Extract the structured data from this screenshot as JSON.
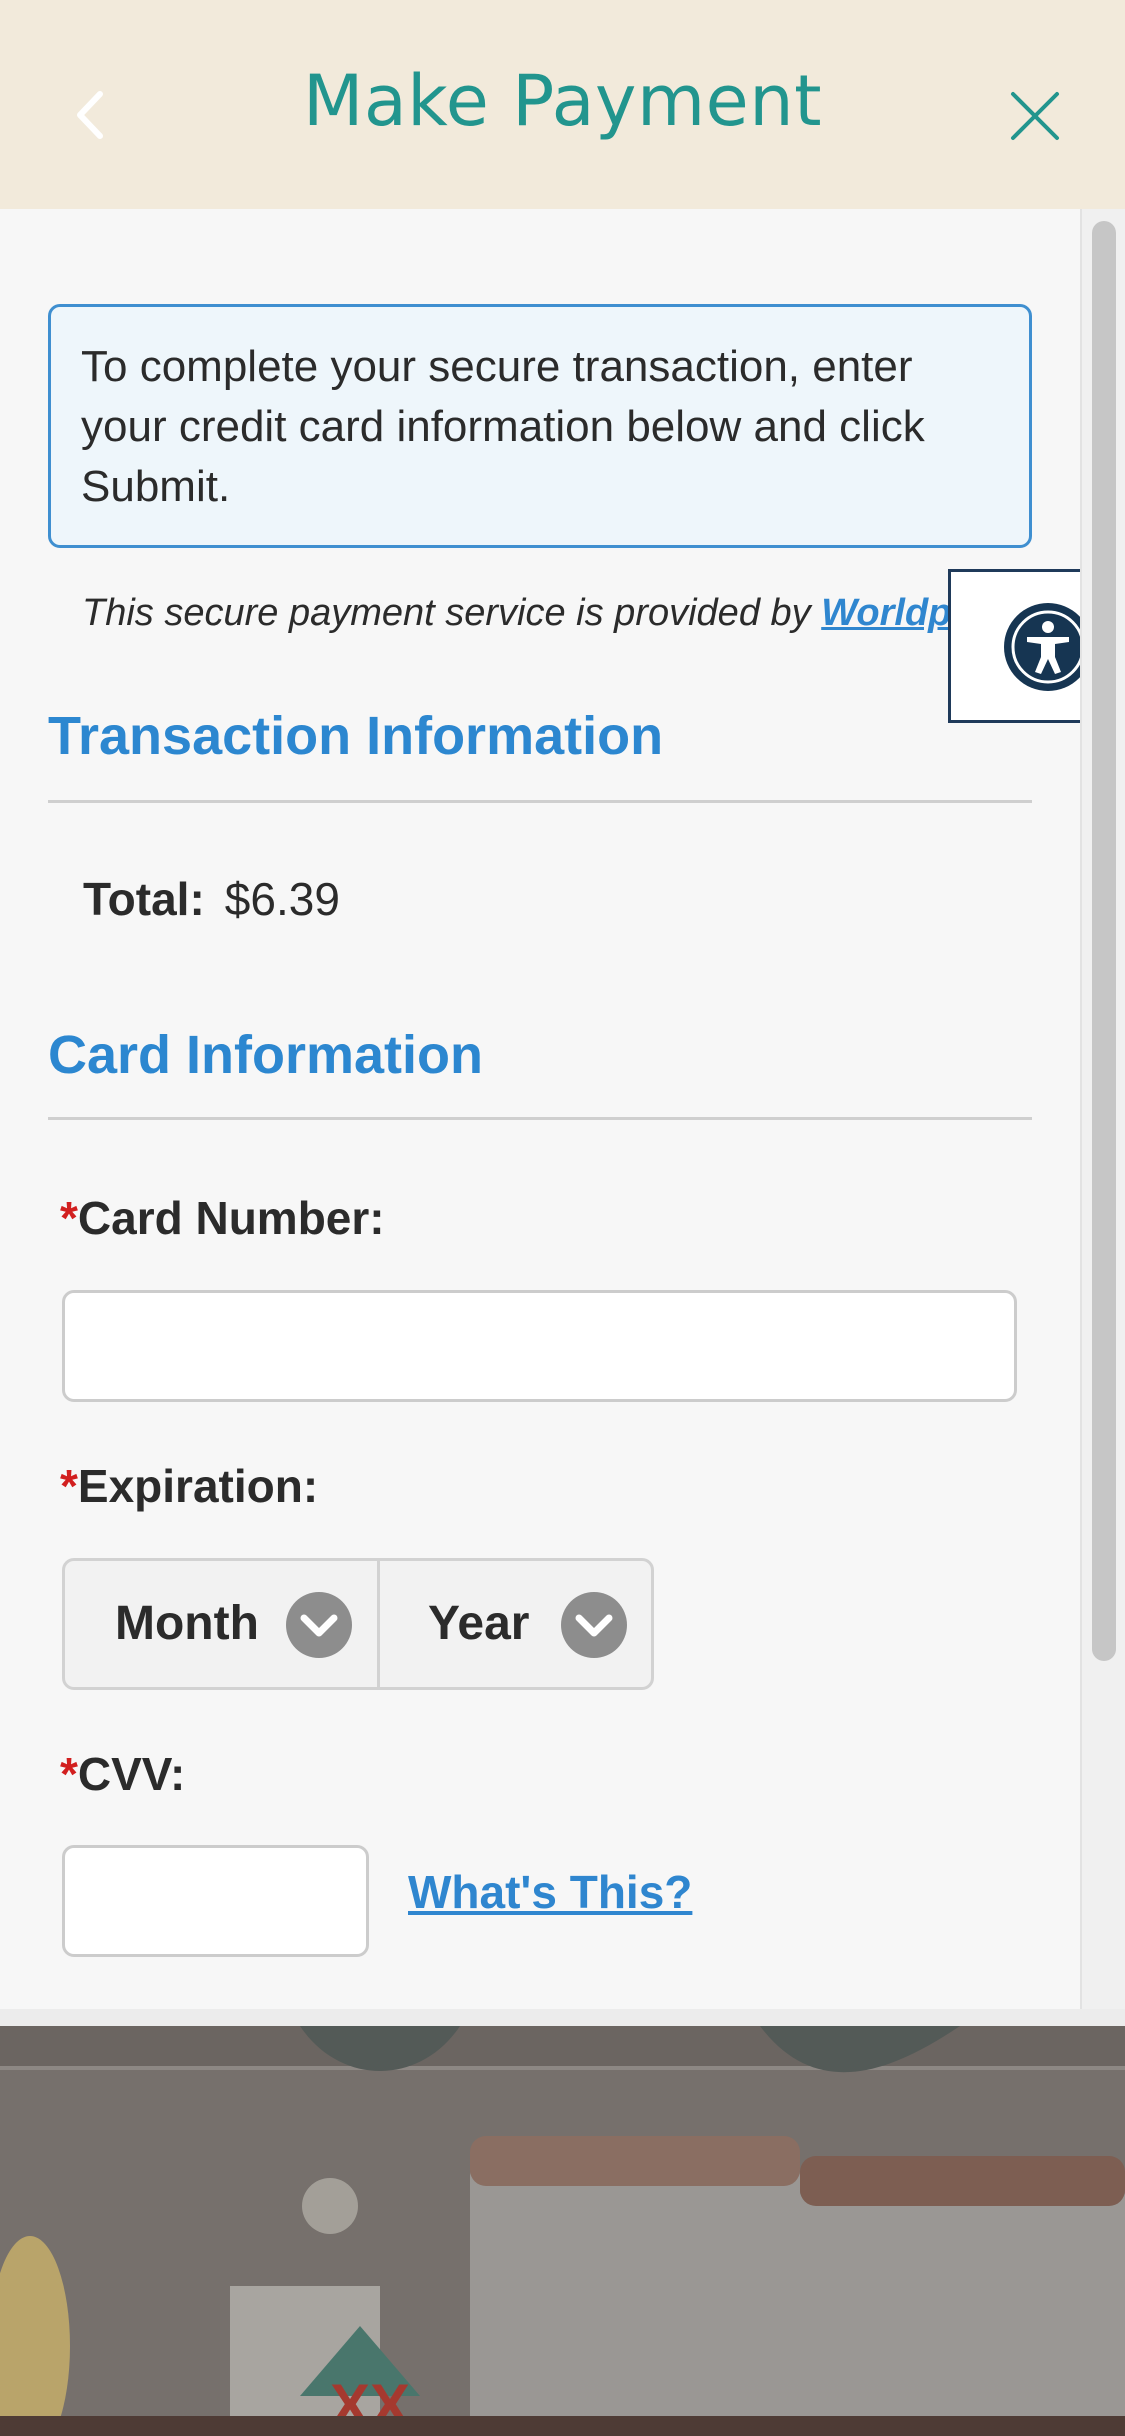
{
  "header": {
    "title": "Make Payment",
    "back_icon": "chevron-left-icon",
    "close_icon": "close-icon",
    "background": "#f2eadb",
    "title_color": "#22958e"
  },
  "notice": {
    "text": "To complete your secure transaction, enter your credit card information below and click Submit."
  },
  "accessibility": {
    "icon": "accessibility-icon"
  },
  "secure_note": {
    "prefix": "This secure payment service is provided by ",
    "link": "Worldpay"
  },
  "transaction": {
    "heading": "Transaction Information",
    "total_label": "Total:",
    "total_value": "$6.39"
  },
  "card": {
    "heading": "Card Information",
    "required_mark": "*",
    "card_number_label": "Card Number:",
    "card_number_value": "",
    "expiration_label": "Expiration:",
    "month_select": "Month",
    "year_select": "Year",
    "cvv_label": "CVV:",
    "cvv_value": "",
    "whats_this": "What's This?"
  },
  "colors": {
    "accent_blue": "#2c87d0",
    "required_red": "#d21f1f",
    "notice_border": "#3f8fd0"
  }
}
